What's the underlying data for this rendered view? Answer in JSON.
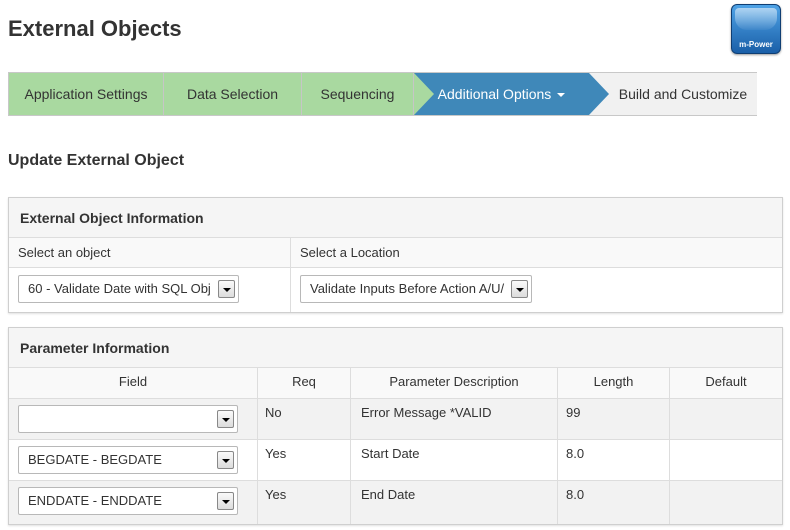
{
  "header": {
    "title": "External Objects",
    "logo_text": "m-Power"
  },
  "wizard": {
    "steps": [
      {
        "label": "Application Settings",
        "state": "done"
      },
      {
        "label": "Data Selection",
        "state": "done"
      },
      {
        "label": "Sequencing",
        "state": "done"
      },
      {
        "label": "Additional Options",
        "state": "active"
      },
      {
        "label": "Build and Customize",
        "state": "pending"
      }
    ]
  },
  "section": {
    "title": "Update External Object"
  },
  "object_info": {
    "title": "External Object Information",
    "object_label": "Select an object",
    "object_value": "60 - Validate Date with SQL Obj",
    "location_label": "Select a Location",
    "location_value": "Validate Inputs Before Action A/U/"
  },
  "parameters": {
    "title": "Parameter Information",
    "columns": [
      "Field",
      "Req",
      "Parameter Description",
      "Length",
      "Default"
    ],
    "rows": [
      {
        "field": "",
        "req": "No",
        "description": "Error Message *VALID",
        "length": "99",
        "default": ""
      },
      {
        "field": "BEGDATE - BEGDATE",
        "req": "Yes",
        "description": "Start Date",
        "length": "8.0",
        "default": ""
      },
      {
        "field": "ENDDATE - ENDDATE",
        "req": "Yes",
        "description": "End Date",
        "length": "8.0",
        "default": ""
      }
    ]
  },
  "colors": {
    "step_done": "#a9d9a0",
    "step_active": "#3f88b9",
    "step_pending": "#f1f1f1"
  }
}
